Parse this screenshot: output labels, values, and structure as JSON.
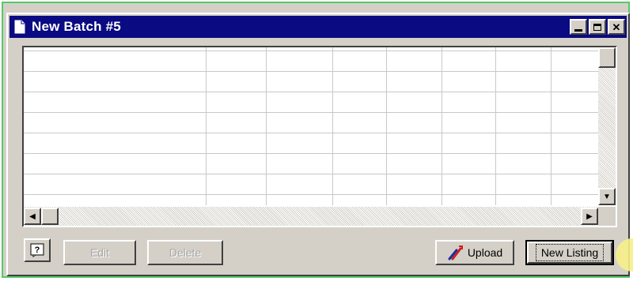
{
  "window": {
    "title": "New Batch #5"
  },
  "buttons": {
    "edit_label": "Edit",
    "delete_label": "Delete",
    "upload_label": "Upload",
    "new_listing_label": "New Listing"
  },
  "icons": {
    "document": "document-icon",
    "help": "help-icon",
    "upload": "upload-icon",
    "minimize": "minimize-icon",
    "maximize": "maximize-icon",
    "close": "close-icon"
  },
  "colors": {
    "titlebar": "#0a0a82",
    "frame_highlight": "#55c86a",
    "cursor_highlight": "#f6ef8a"
  }
}
